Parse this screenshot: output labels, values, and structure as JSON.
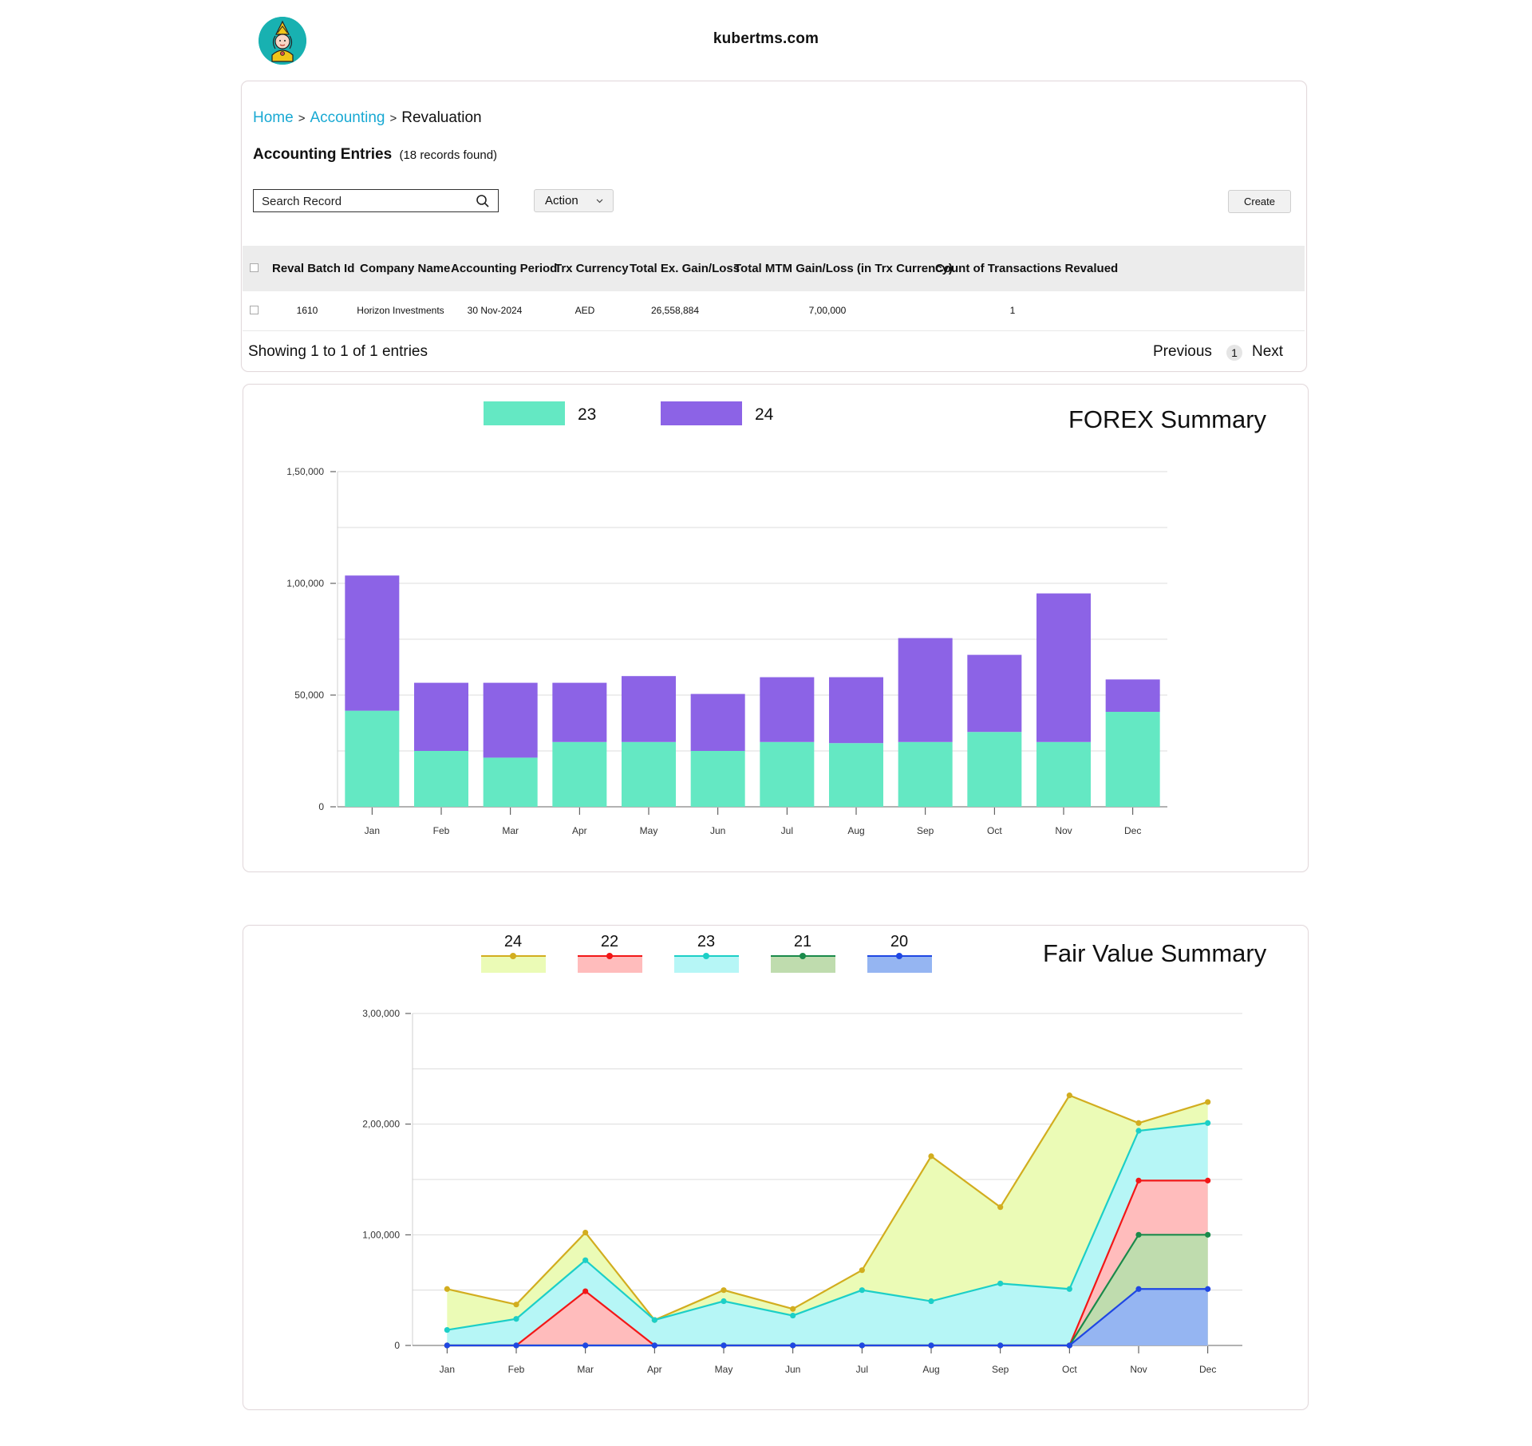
{
  "site": {
    "title": "kubertms.com"
  },
  "breadcrumb": {
    "home": "Home",
    "accounting": "Accounting",
    "current": "Revaluation",
    "sep": ">"
  },
  "entries": {
    "title": "Accounting Entries",
    "count_text": "(18 records found)",
    "search_placeholder": "Search Record",
    "action_label": "Action",
    "create_label": "Create",
    "columns": [
      "Reval Batch Id",
      "Company Name",
      "Accounting Period",
      "Trx Currency",
      "Total Ex. Gain/Loss",
      "Total MTM Gain/Loss (in Trx Currency)",
      "Count of Transactions Revalued"
    ],
    "rows": [
      [
        "1610",
        "Horizon Investments",
        "30 Nov-2024",
        "AED",
        "26,558,884",
        "7,00,000",
        "1"
      ]
    ],
    "footer": "Showing 1 to 1 of 1 entries",
    "previous": "Previous",
    "page": "1",
    "next": "Next"
  },
  "colors": {
    "link": "#19a9d3",
    "forex_23": "#64e8c3",
    "forex_24": "#8c63e6",
    "fv_24_fill": "#ebfbb6",
    "fv_24_line": "#d2ad1f",
    "fv_22_fill": "#ffbcbc",
    "fv_22_line": "#f21717",
    "fv_23_fill": "#b6f6f6",
    "fv_23_line": "#1ccfc7",
    "fv_21_fill": "#bfdcae",
    "fv_21_line": "#1a8a4a",
    "fv_20_fill": "#95b5f2",
    "fv_20_line": "#1f47e3"
  },
  "chart_data": [
    {
      "type": "bar",
      "stacked": true,
      "title": "FOREX Summary",
      "categories": [
        "Jan",
        "Feb",
        "Mar",
        "Apr",
        "May",
        "Jun",
        "Jul",
        "Aug",
        "Sep",
        "Oct",
        "Nov",
        "Dec"
      ],
      "series": [
        {
          "name": "23",
          "values": [
            43000,
            25000,
            22000,
            29000,
            29000,
            25000,
            29000,
            28500,
            29000,
            33500,
            29000,
            42500
          ]
        },
        {
          "name": "24",
          "values": [
            60500,
            30500,
            33500,
            26500,
            29500,
            25500,
            29000,
            29500,
            46500,
            34500,
            66500,
            14500
          ]
        }
      ],
      "yticks": [
        "0",
        "50,000",
        "1,00,000",
        "1,50,000"
      ],
      "ylim": [
        0,
        150000
      ],
      "grid": true,
      "legend": "top"
    },
    {
      "type": "area",
      "title": "Fair Value Summary",
      "categories": [
        "Jan",
        "Feb",
        "Mar",
        "Apr",
        "May",
        "Jun",
        "Jul",
        "Aug",
        "Sep",
        "Oct",
        "Nov",
        "Dec"
      ],
      "series": [
        {
          "name": "24",
          "values": [
            51000,
            37000,
            102000,
            23000,
            50000,
            33000,
            68000,
            171000,
            125000,
            226000,
            201000,
            220000
          ]
        },
        {
          "name": "22",
          "values": [
            0,
            0,
            49000,
            0,
            0,
            0,
            0,
            0,
            0,
            0,
            149000,
            149000
          ]
        },
        {
          "name": "23",
          "values": [
            14000,
            24000,
            77000,
            23000,
            40000,
            27000,
            50000,
            40000,
            56000,
            51000,
            194000,
            201000
          ]
        },
        {
          "name": "21",
          "values": [
            0,
            0,
            0,
            0,
            0,
            0,
            0,
            0,
            0,
            0,
            100000,
            100000
          ]
        },
        {
          "name": "20",
          "values": [
            0,
            0,
            0,
            0,
            0,
            0,
            0,
            0,
            0,
            0,
            51000,
            51000
          ]
        }
      ],
      "yticks": [
        "0",
        "1,00,000",
        "2,00,000",
        "3,00,000"
      ],
      "ylim": [
        0,
        300000
      ],
      "grid": true,
      "legend": "top"
    }
  ]
}
